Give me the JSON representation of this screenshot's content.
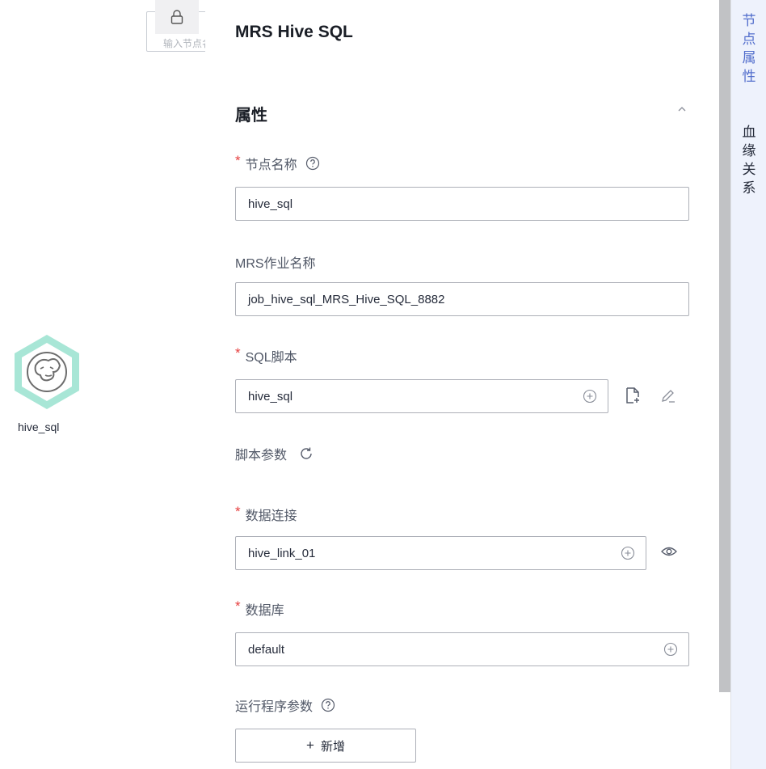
{
  "canvas": {
    "search_placeholder": "输入节点名称",
    "node_label": "hive_sql"
  },
  "panel": {
    "title": "MRS Hive SQL",
    "section_title": "属性",
    "fields": {
      "node_name": {
        "label": "节点名称",
        "value": "hive_sql"
      },
      "mrs_job_name": {
        "label": "MRS作业名称",
        "value": "job_hive_sql_MRS_Hive_SQL_8882"
      },
      "sql_script": {
        "label": "SQL脚本",
        "value": "hive_sql"
      },
      "script_params": {
        "label": "脚本参数"
      },
      "data_connection": {
        "label": "数据连接",
        "value": "hive_link_01"
      },
      "database": {
        "label": "数据库",
        "value": "default"
      },
      "runner_params": {
        "label": "运行程序参数"
      }
    },
    "add_button": "新增"
  },
  "right_tabs": {
    "node_properties": [
      "节",
      "点",
      "属",
      "性"
    ],
    "lineage": [
      "血",
      "缘",
      "关",
      "系"
    ]
  },
  "colors": {
    "accent": "#526ecc",
    "required": "#e64040",
    "node_ring": "#a8e6d6"
  }
}
